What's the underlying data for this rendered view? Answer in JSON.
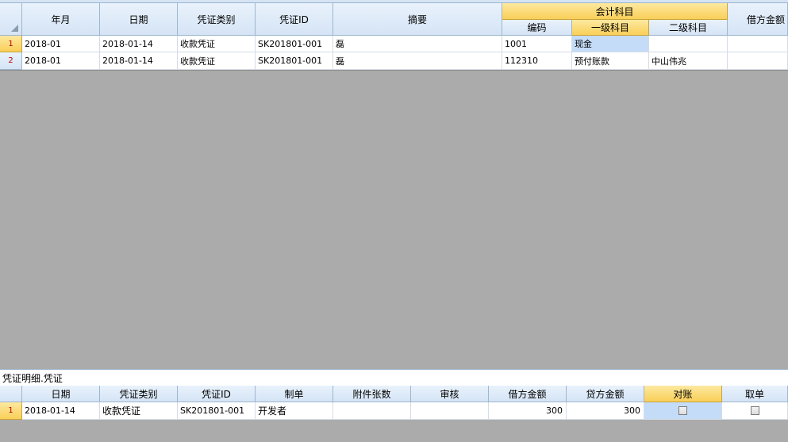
{
  "main_grid": {
    "group_header": "会计科目",
    "columns": {
      "month": "年月",
      "date": "日期",
      "voucher_type": "凭证类别",
      "voucher_id": "凭证ID",
      "summary": "摘要",
      "code": "编码",
      "level1": "一级科目",
      "level2": "二级科目",
      "debit": "借方金额"
    },
    "rows": [
      {
        "num": "1",
        "month": "2018-01",
        "date": "2018-01-14",
        "voucher_type": "收款凭证",
        "voucher_id": "SK201801-001",
        "summary": "磊",
        "code": "1001",
        "level1": "现金",
        "level2": "",
        "debit": ""
      },
      {
        "num": "2",
        "month": "2018-01",
        "date": "2018-01-14",
        "voucher_type": "收款凭证",
        "voucher_id": "SK201801-001",
        "summary": "磊",
        "code": "112310",
        "level1": "预付账款",
        "level2": "中山伟兆",
        "debit": ""
      }
    ]
  },
  "detail_caption": "凭证明细.凭证",
  "detail_grid": {
    "columns": {
      "date": "日期",
      "voucher_type": "凭证类别",
      "voucher_id": "凭证ID",
      "maker": "制单",
      "attachments": "附件张数",
      "review": "审核",
      "debit": "借方金额",
      "credit": "贷方金额",
      "reconcile": "对账",
      "cancel": "取单"
    },
    "rows": [
      {
        "num": "1",
        "date": "2018-01-14",
        "voucher_type": "收款凭证",
        "voucher_id": "SK201801-001",
        "maker": "开发者",
        "attachments": "",
        "review": "",
        "debit": "300",
        "credit": "300",
        "reconcile": false,
        "cancel": false
      }
    ]
  },
  "colors": {
    "selected_header": "#f9cf58",
    "selected_cell": "#c4dcf7",
    "empty_area": "#ababab",
    "row_number": "#c00000"
  }
}
